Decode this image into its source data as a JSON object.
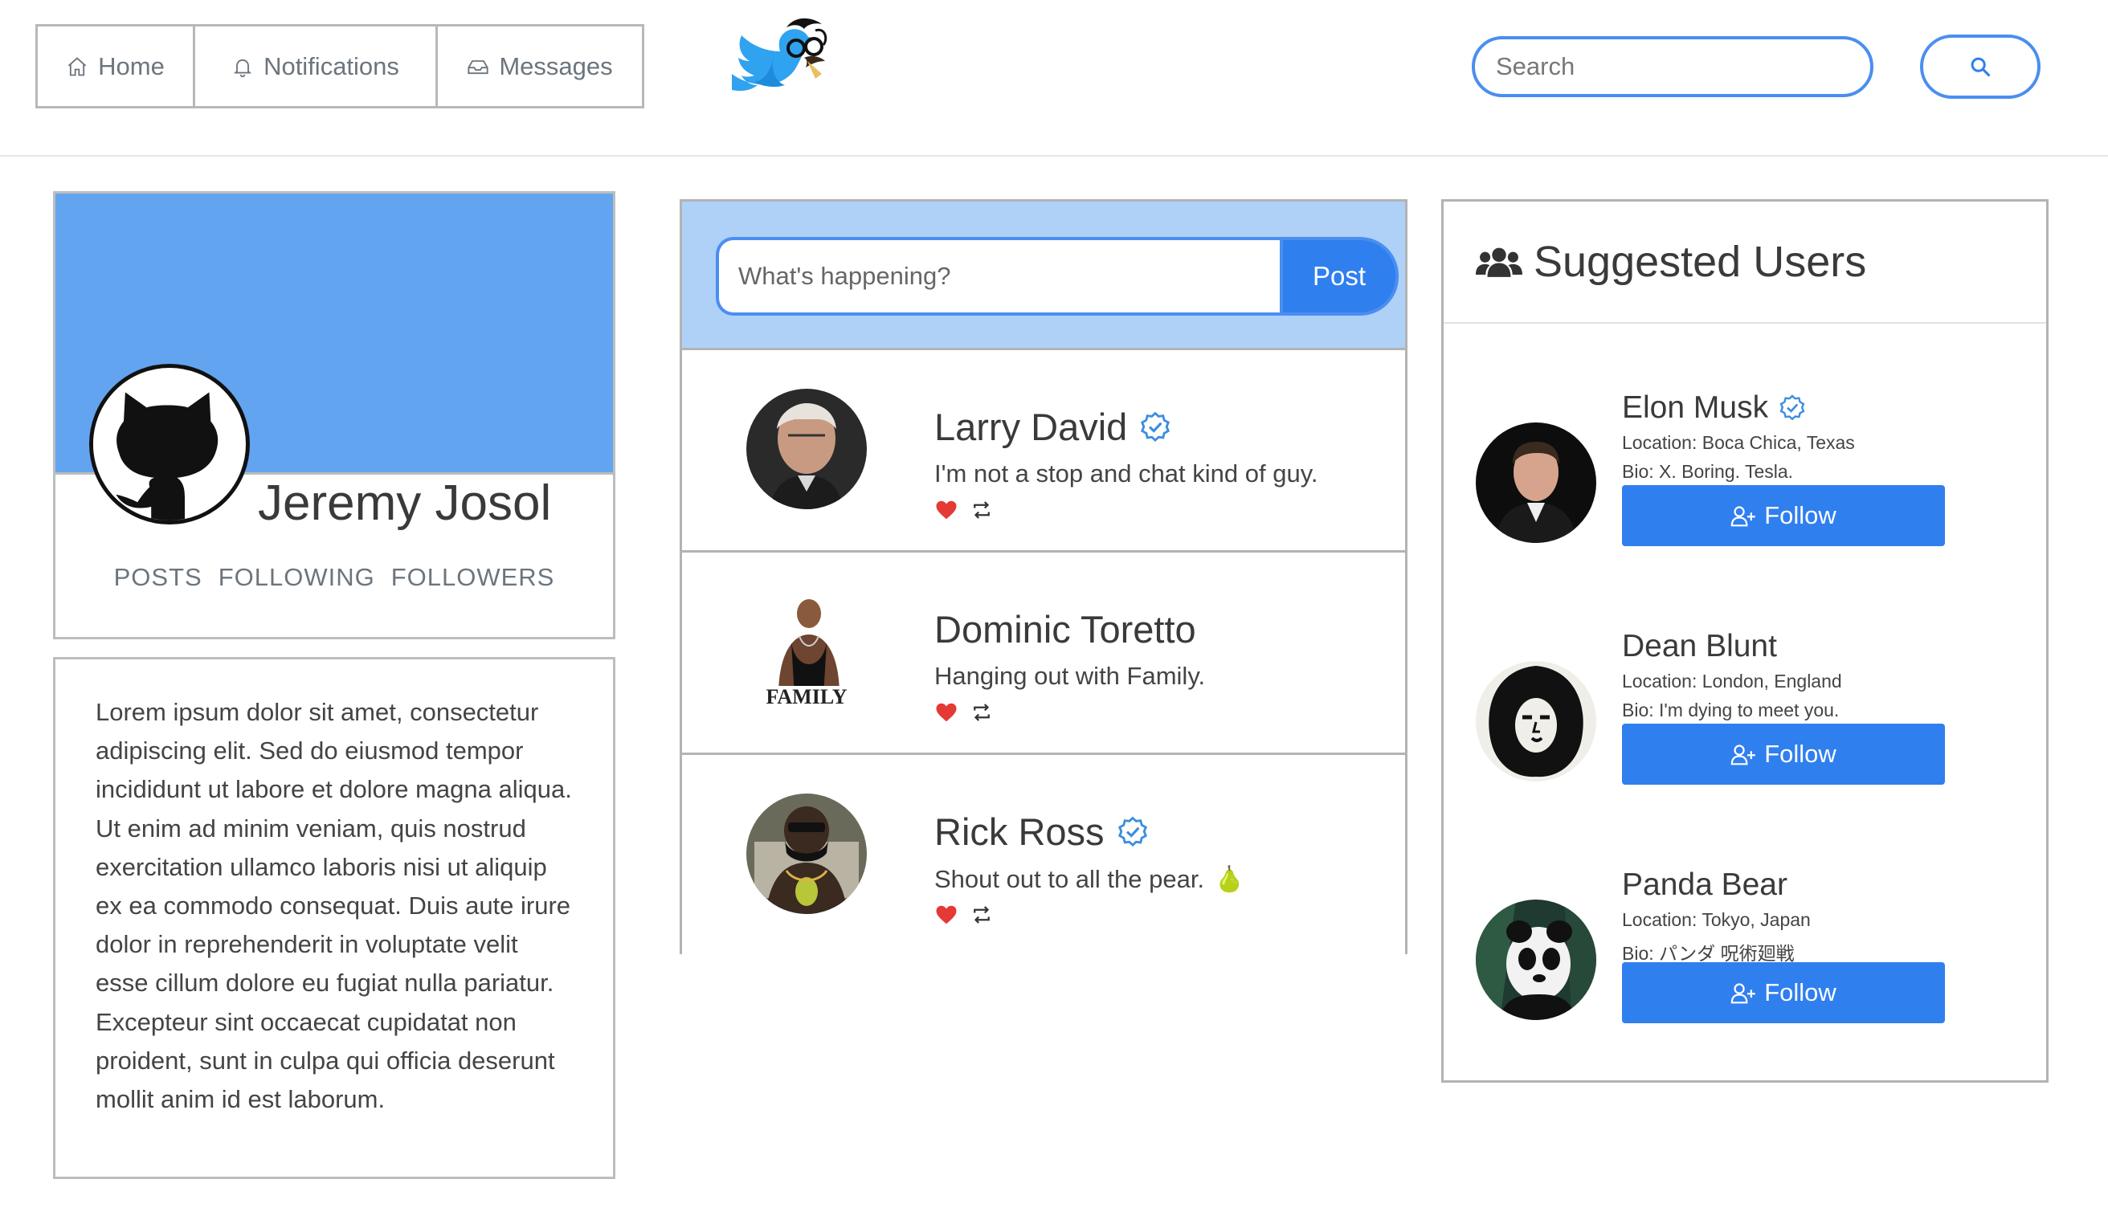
{
  "nav": {
    "home": "Home",
    "notifications": "Notifications",
    "messages": "Messages"
  },
  "search": {
    "placeholder": "Search"
  },
  "profile": {
    "name": "Jeremy Josol",
    "stats": {
      "posts": "POSTS",
      "following": "FOLLOWING",
      "followers": "FOLLOWERS"
    }
  },
  "bio": {
    "text": "Lorem ipsum dolor sit amet, consectetur adipiscing elit. Sed do eiusmod tempor incididunt ut labore et dolore magna aliqua. Ut enim ad minim veniam, quis nostrud exercitation ullamco laboris nisi ut aliquip ex ea commodo consequat. Duis aute irure dolor in reprehenderit in voluptate velit esse cillum dolore eu fugiat nulla pariatur. Excepteur sint occaecat cupidatat non proident, sunt in culpa qui officia deserunt mollit anim id est laborum."
  },
  "composer": {
    "placeholder": "What's happening?",
    "post_label": "Post"
  },
  "tweets": [
    {
      "name": "Larry David",
      "verified": true,
      "text": "I'm not a stop and chat kind of guy.",
      "emoji": ""
    },
    {
      "name": "Dominic Toretto",
      "verified": false,
      "text": "Hanging out with Family.",
      "emoji": ""
    },
    {
      "name": "Rick Ross",
      "verified": true,
      "text": "Shout out to all the pear.",
      "emoji": "🍐"
    }
  ],
  "suggested": {
    "title": "Suggested Users",
    "follow_label": "Follow",
    "users": [
      {
        "name": "Elon Musk",
        "verified": true,
        "location": "Location: Boca Chica, Texas",
        "bio": "Bio: X. Boring. Tesla."
      },
      {
        "name": "Dean Blunt",
        "verified": false,
        "location": "Location: London, England",
        "bio": "Bio: I'm dying to meet you."
      },
      {
        "name": "Panda Bear",
        "verified": false,
        "location": "Location: Tokyo, Japan",
        "bio": "Bio: パンダ 呪術廻戦"
      }
    ]
  },
  "colors": {
    "accent": "#2f7fef",
    "banner": "#63a4f1",
    "composer_bg": "#afd1f8",
    "heart": "#e53935",
    "verified": "#3b8de0"
  },
  "icons": {
    "home": "home-icon",
    "notifications": "bell-icon",
    "messages": "inbox-icon",
    "search": "magnifier-icon",
    "verified": "verified-badge-icon",
    "like": "heart-icon",
    "retweet": "retweet-icon",
    "users": "users-icon",
    "follow": "user-plus-icon"
  }
}
